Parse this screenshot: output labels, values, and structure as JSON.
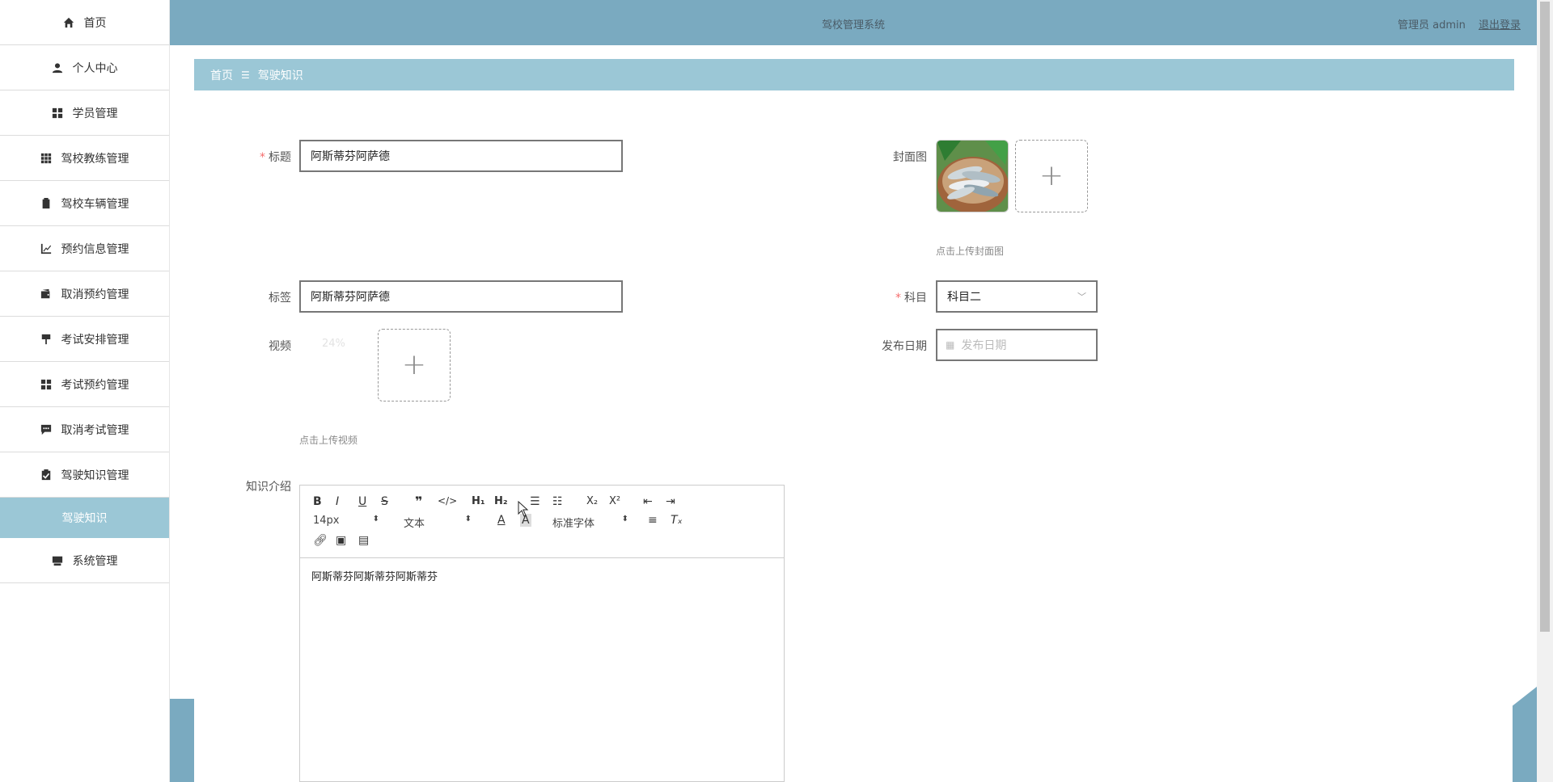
{
  "app": {
    "title": "驾校管理系统"
  },
  "header": {
    "user": "管理员 admin",
    "logout": "退出登录"
  },
  "sidebar": {
    "items": [
      {
        "label": "首页",
        "icon": "home-icon"
      },
      {
        "label": "个人中心",
        "icon": "user-icon"
      },
      {
        "label": "学员管理",
        "icon": "grid-icon"
      },
      {
        "label": "驾校教练管理",
        "icon": "apps-icon"
      },
      {
        "label": "驾校车辆管理",
        "icon": "clipboard-icon"
      },
      {
        "label": "预约信息管理",
        "icon": "chart-icon"
      },
      {
        "label": "取消预约管理",
        "icon": "wallet-icon"
      },
      {
        "label": "考试安排管理",
        "icon": "flag-icon"
      },
      {
        "label": "考试预约管理",
        "icon": "grid-icon"
      },
      {
        "label": "取消考试管理",
        "icon": "message-icon"
      },
      {
        "label": "驾驶知识管理",
        "icon": "checklist-icon"
      }
    ],
    "active_sub": "驾驶知识",
    "last_item": {
      "label": "系统管理",
      "icon": "monitor-icon"
    }
  },
  "breadcrumb": {
    "home": "首页",
    "separator": "☰",
    "current": "驾驶知识"
  },
  "form": {
    "title_label": "标题",
    "title_value": "阿斯蒂芬阿萨德",
    "cover_label": "封面图",
    "cover_hint": "点击上传封面图",
    "tag_label": "标签",
    "tag_value": "阿斯蒂芬阿萨德",
    "subject_label": "科目",
    "subject_value": "科目二",
    "video_label": "视频",
    "video_progress": "24%",
    "video_hint": "点击上传视频",
    "date_label": "发布日期",
    "date_placeholder": "发布日期",
    "intro_label": "知识介绍"
  },
  "editor": {
    "font_size": "14px",
    "text_type": "文本",
    "font_family": "标准字体",
    "content": "阿斯蒂芬阿斯蒂芬阿斯蒂芬"
  },
  "colors": {
    "header_bg": "#7aaac0",
    "breadcrumb_bg": "#9bc7d6",
    "required": "#f56c6c"
  }
}
